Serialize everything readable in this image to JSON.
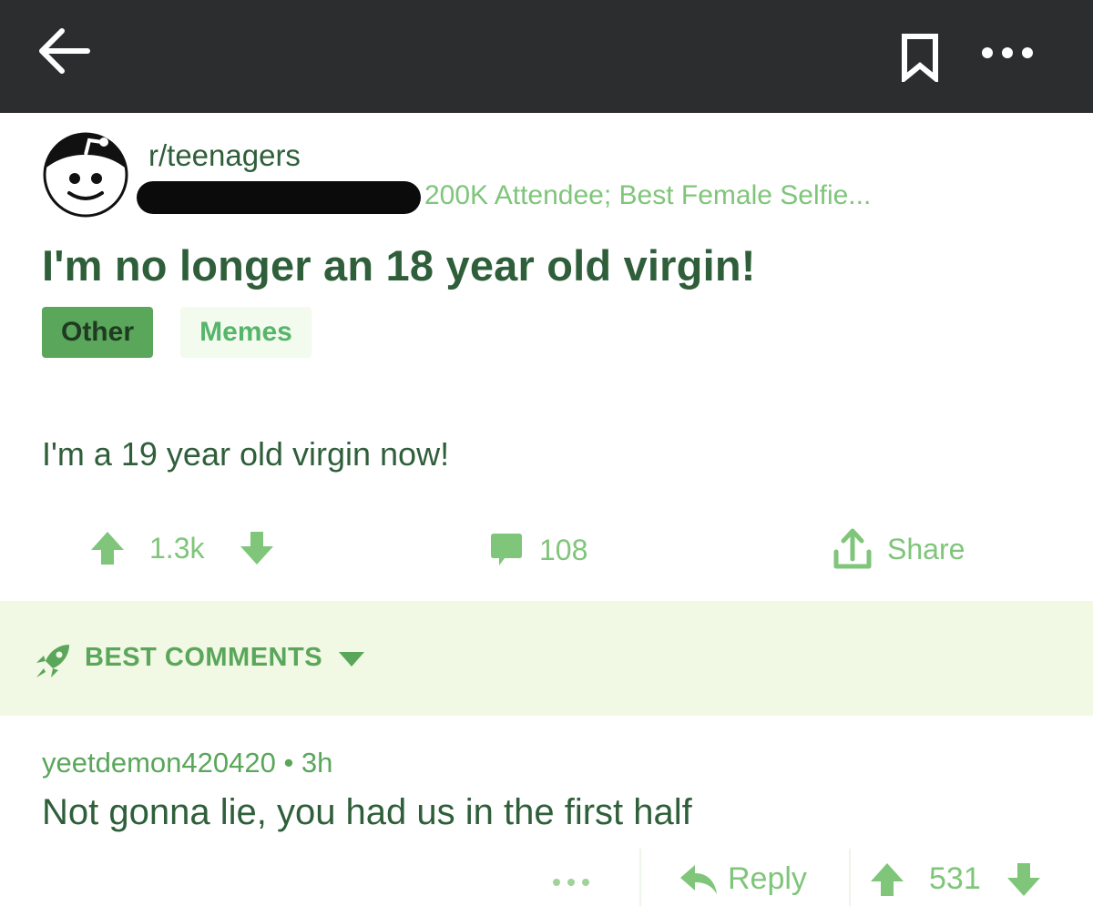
{
  "nav": {
    "back_icon": "arrow-left-icon",
    "bookmark_icon": "bookmark-icon",
    "more_icon": "more-horizontal-icon"
  },
  "post": {
    "subreddit": "r/teenagers",
    "user_flair": "200K Attendee; Best Female Selfie...",
    "title": "I'm no longer an 18 year old virgin!",
    "tags": [
      "Other",
      "Memes"
    ],
    "body": "I'm a 19 year old virgin now!",
    "score": "1.3k",
    "comment_count": "108",
    "share_label": "Share"
  },
  "sort": {
    "label": "BEST COMMENTS",
    "icon": "rocket-icon"
  },
  "comment": {
    "author": "yeetdemon420420",
    "age": "3h",
    "text": "Not gonna lie, you had us in the first half",
    "reply_label": "Reply",
    "score": "531"
  },
  "colors": {
    "topbar": "#2c2d2f",
    "primary_text": "#2f5f3a",
    "accent": "#7fc57a",
    "tag_other_bg": "#5aa65a",
    "sort_bg": "#f1f8e3"
  }
}
